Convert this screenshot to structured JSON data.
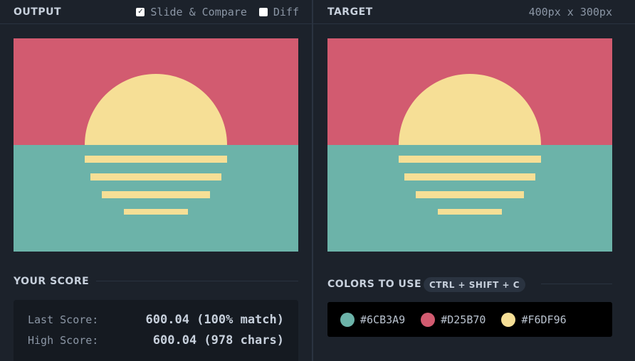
{
  "output_panel": {
    "title": "OUTPUT",
    "slide_compare_label": "Slide & Compare",
    "slide_compare_checked": true,
    "diff_label": "Diff",
    "diff_checked": false
  },
  "target_panel": {
    "title": "TARGET",
    "dimensions": "400px x 300px"
  },
  "score": {
    "title": "YOUR SCORE",
    "last_label": "Last Score:",
    "last_value": "600.04 (100% match)",
    "high_label": "High Score:",
    "high_value": "600.04 (978 chars)"
  },
  "colors": {
    "title": "COLORS TO USE",
    "shortcut": "CTRL + SHIFT + C",
    "items": [
      {
        "hex": "#6CB3A9",
        "color": "#6CB3A9"
      },
      {
        "hex": "#D25B70",
        "color": "#D25B70"
      },
      {
        "hex": "#F6DF96",
        "color": "#F6DF96"
      }
    ]
  },
  "image": {
    "sky_color": "#D25B70",
    "sea_color": "#6CB3A9",
    "sun_color": "#F6DF96"
  }
}
